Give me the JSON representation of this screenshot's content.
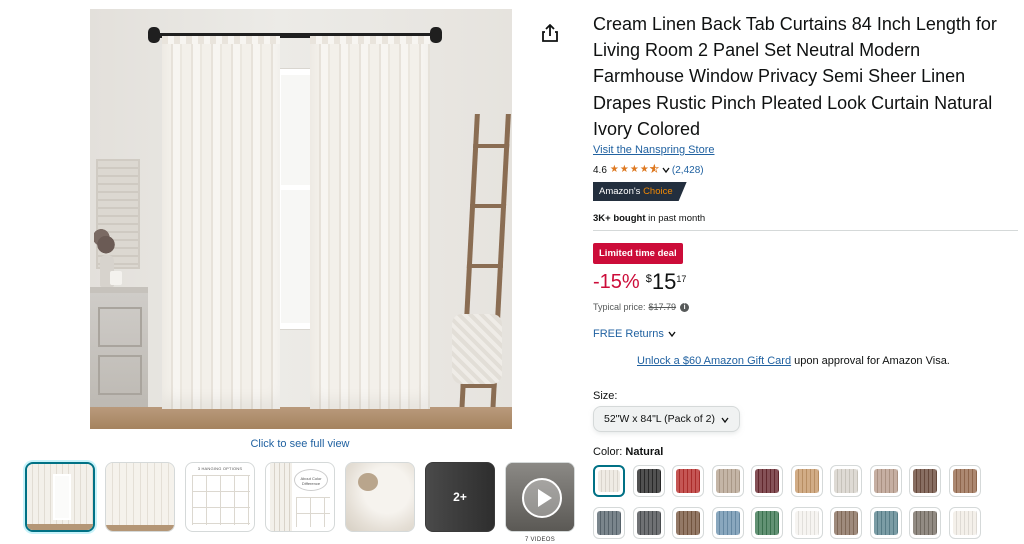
{
  "product": {
    "title": "Cream Linen Back Tab Curtains 84 Inch Length for Living Room 2 Panel Set Neutral Modern Farmhouse Window Privacy Semi Sheer Linen Drapes Rustic Pinch Pleated Look Curtain Natural Ivory Colored",
    "store_link": "Visit the Nanspring Store",
    "rating": "4.6",
    "rating_stars": 4.5,
    "review_count": "(2,428)",
    "badge_prefix": "Amazon's",
    "badge_choice": "Choice",
    "bought_bold": "3K+ bought",
    "bought_rest": " in past month"
  },
  "pricing": {
    "deal_label": "Limited time deal",
    "discount": "-15%",
    "currency": "$",
    "whole": "15",
    "fraction": "17",
    "typical_label": "Typical price:",
    "typical_price": "$17.79",
    "returns": "FREE Returns"
  },
  "gift": {
    "link": "Unlock a $60 Amazon Gift Card",
    "rest": " upon approval for Amazon Visa."
  },
  "size": {
    "label": "Size:",
    "selected": "52\"W x 84\"L (Pack of 2)"
  },
  "color": {
    "label": "Color: ",
    "selected": "Natural",
    "swatches": [
      {
        "hex": "#ece7de"
      },
      {
        "hex": "#2b2b2b"
      },
      {
        "hex": "#b8312f"
      },
      {
        "hex": "#b7a592"
      },
      {
        "hex": "#6a2b32"
      },
      {
        "hex": "#c79a6b"
      },
      {
        "hex": "#d7d2ca"
      },
      {
        "hex": "#b99d8d"
      },
      {
        "hex": "#6e4e40"
      },
      {
        "hex": "#9a6e52"
      },
      {
        "hex": "#5d6a73"
      },
      {
        "hex": "#4f5256"
      },
      {
        "hex": "#7b5b44"
      },
      {
        "hex": "#6f94b0"
      },
      {
        "hex": "#3f7a55"
      },
      {
        "hex": "#f4f2ee"
      },
      {
        "hex": "#8a7260"
      },
      {
        "hex": "#5e8791"
      },
      {
        "hex": "#7a7268"
      },
      {
        "hex": "#f1ede6"
      }
    ]
  },
  "gallery": {
    "see_full": "Click to see full view",
    "thumb_3_caption": "3 HANGING OPTIONS",
    "thumb_4_caption": "About Color Difference",
    "more_label": "2+",
    "videos_label": "7 VIDEOS"
  },
  "colors": {
    "link": "#2162a1",
    "deal_red": "#cc0c39",
    "star": "#de7921",
    "badge_bg": "#232f3e",
    "badge_choice": "#f08804",
    "selected_border": "#007185"
  },
  "icons": {
    "share": "share-icon",
    "chevron": "chevron-down-icon",
    "info": "info-icon",
    "play": "play-icon"
  }
}
